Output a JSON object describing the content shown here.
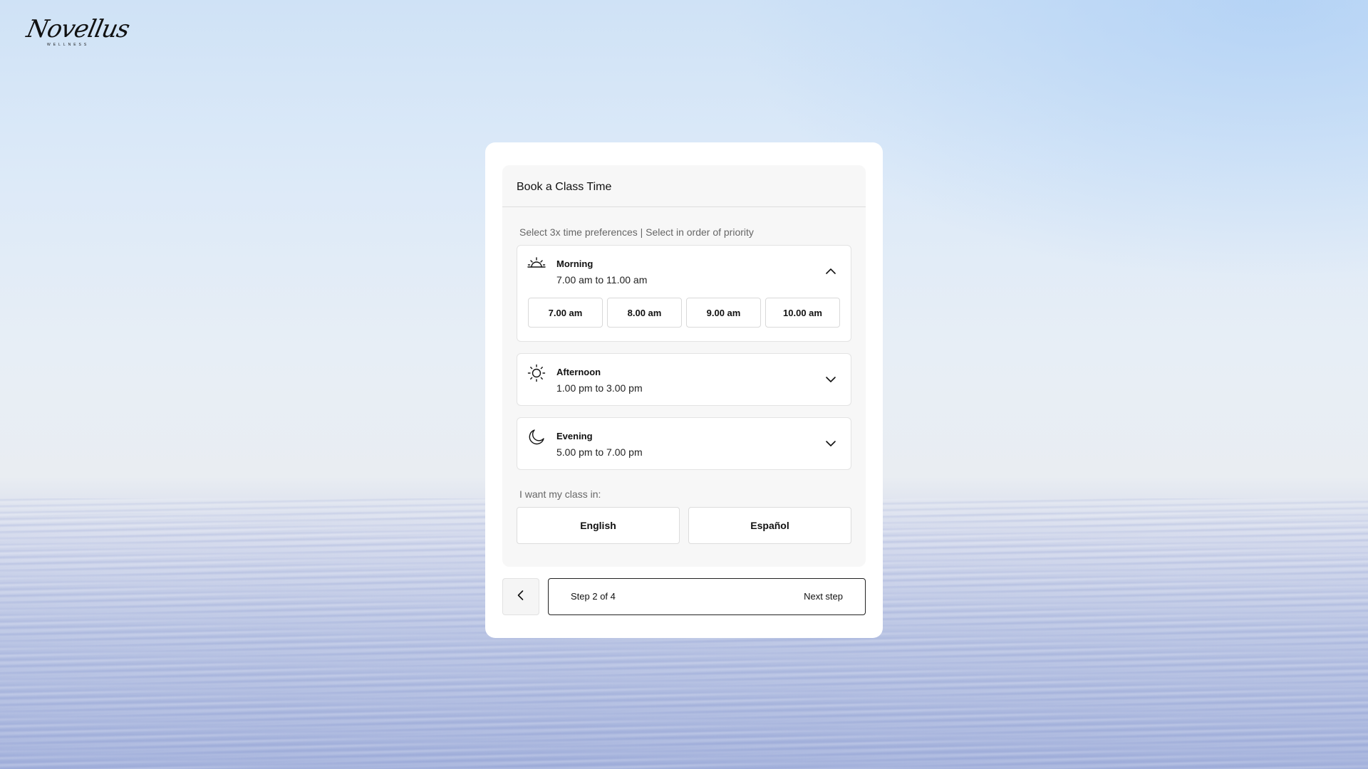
{
  "brand": {
    "logo_script": "Novellus",
    "logo_sub": "WELLNESS"
  },
  "booking": {
    "title": "Book a Class Time",
    "instruction": "Select 3x time preferences | Select in order of priority",
    "sections": [
      {
        "name": "Morning",
        "range": "7.00 am to 11.00 am",
        "icon": "sunrise-icon",
        "expanded": true,
        "chevron": "chevron-up-icon",
        "slots": [
          "7.00 am",
          "8.00 am",
          "9.00 am",
          "10.00 am"
        ]
      },
      {
        "name": "Afternoon",
        "range": "1.00 pm to 3.00 pm",
        "icon": "sun-icon",
        "expanded": false,
        "chevron": "chevron-down-icon"
      },
      {
        "name": "Evening",
        "range": "5.00 pm to 7.00 pm",
        "icon": "moon-icon",
        "expanded": false,
        "chevron": "chevron-down-icon"
      }
    ],
    "language_label": "I want my class in:",
    "languages": [
      "English",
      "Español"
    ]
  },
  "footer": {
    "back_icon": "chevron-left-icon",
    "step_text": "Step 2 of 4",
    "next_label": "Next step"
  }
}
